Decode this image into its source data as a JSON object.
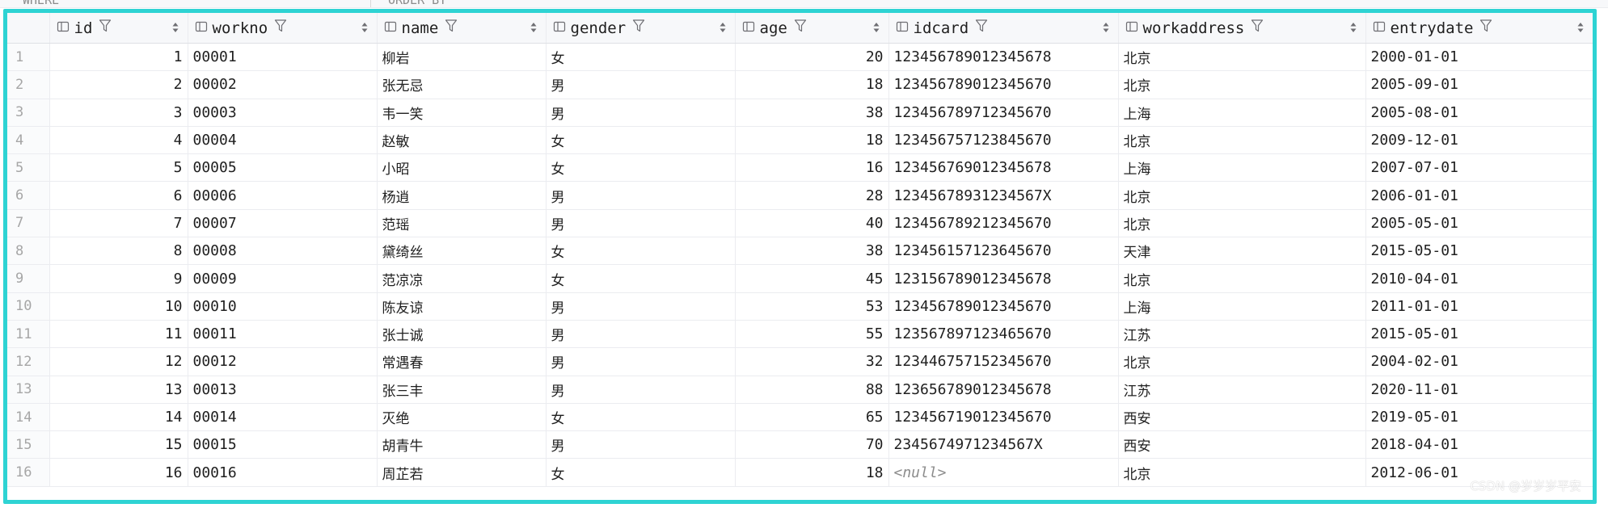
{
  "topbar": {
    "left_text": "WHERE",
    "right_text": "ORDER BY"
  },
  "columns": [
    {
      "name": "id",
      "icon": "column-icon"
    },
    {
      "name": "workno",
      "icon": "column-icon"
    },
    {
      "name": "name",
      "icon": "column-icon"
    },
    {
      "name": "gender",
      "icon": "column-icon"
    },
    {
      "name": "age",
      "icon": "column-icon"
    },
    {
      "name": "idcard",
      "icon": "column-icon"
    },
    {
      "name": "workaddress",
      "icon": "column-icon"
    },
    {
      "name": "entrydate",
      "icon": "column-icon"
    }
  ],
  "rows": [
    {
      "rn": "1",
      "id": "1",
      "workno": "00001",
      "name": "柳岩",
      "gender": "女",
      "age": "20",
      "idcard": "123456789012345678",
      "workaddress": "北京",
      "entrydate": "2000-01-01"
    },
    {
      "rn": "2",
      "id": "2",
      "workno": "00002",
      "name": "张无忌",
      "gender": "男",
      "age": "18",
      "idcard": "123456789012345670",
      "workaddress": "北京",
      "entrydate": "2005-09-01"
    },
    {
      "rn": "3",
      "id": "3",
      "workno": "00003",
      "name": "韦一笑",
      "gender": "男",
      "age": "38",
      "idcard": "123456789712345670",
      "workaddress": "上海",
      "entrydate": "2005-08-01"
    },
    {
      "rn": "4",
      "id": "4",
      "workno": "00004",
      "name": "赵敏",
      "gender": "女",
      "age": "18",
      "idcard": "123456757123845670",
      "workaddress": "北京",
      "entrydate": "2009-12-01"
    },
    {
      "rn": "5",
      "id": "5",
      "workno": "00005",
      "name": "小昭",
      "gender": "女",
      "age": "16",
      "idcard": "123456769012345678",
      "workaddress": "上海",
      "entrydate": "2007-07-01"
    },
    {
      "rn": "6",
      "id": "6",
      "workno": "00006",
      "name": "杨逍",
      "gender": "男",
      "age": "28",
      "idcard": "12345678931234567X",
      "workaddress": "北京",
      "entrydate": "2006-01-01"
    },
    {
      "rn": "7",
      "id": "7",
      "workno": "00007",
      "name": "范瑶",
      "gender": "男",
      "age": "40",
      "idcard": "123456789212345670",
      "workaddress": "北京",
      "entrydate": "2005-05-01"
    },
    {
      "rn": "8",
      "id": "8",
      "workno": "00008",
      "name": "黛绮丝",
      "gender": "女",
      "age": "38",
      "idcard": "123456157123645670",
      "workaddress": "天津",
      "entrydate": "2015-05-01"
    },
    {
      "rn": "9",
      "id": "9",
      "workno": "00009",
      "name": "范凉凉",
      "gender": "女",
      "age": "45",
      "idcard": "123156789012345678",
      "workaddress": "北京",
      "entrydate": "2010-04-01"
    },
    {
      "rn": "10",
      "id": "10",
      "workno": "00010",
      "name": "陈友谅",
      "gender": "男",
      "age": "53",
      "idcard": "123456789012345670",
      "workaddress": "上海",
      "entrydate": "2011-01-01"
    },
    {
      "rn": "11",
      "id": "11",
      "workno": "00011",
      "name": "张士诚",
      "gender": "男",
      "age": "55",
      "idcard": "123567897123465670",
      "workaddress": "江苏",
      "entrydate": "2015-05-01"
    },
    {
      "rn": "12",
      "id": "12",
      "workno": "00012",
      "name": "常遇春",
      "gender": "男",
      "age": "32",
      "idcard": "123446757152345670",
      "workaddress": "北京",
      "entrydate": "2004-02-01"
    },
    {
      "rn": "13",
      "id": "13",
      "workno": "00013",
      "name": "张三丰",
      "gender": "男",
      "age": "88",
      "idcard": "123656789012345678",
      "workaddress": "江苏",
      "entrydate": "2020-11-01"
    },
    {
      "rn": "14",
      "id": "14",
      "workno": "00014",
      "name": "灭绝",
      "gender": "女",
      "age": "65",
      "idcard": "123456719012345670",
      "workaddress": "西安",
      "entrydate": "2019-05-01"
    },
    {
      "rn": "15",
      "id": "15",
      "workno": "00015",
      "name": "胡青牛",
      "gender": "男",
      "age": "70",
      "idcard": "2345674971234567X",
      "workaddress": "西安",
      "entrydate": "2018-04-01"
    },
    {
      "rn": "16",
      "id": "16",
      "workno": "00016",
      "name": "周芷若",
      "gender": "女",
      "age": "18",
      "idcard": "<null>",
      "workaddress": "北京",
      "entrydate": "2012-06-01"
    }
  ],
  "watermark": "CSDN @岁岁岁平安",
  "colors": {
    "frame": "#2ed3d3",
    "header_bg": "#f7f8fa",
    "grid": "#ebecf0",
    "rownum": "#a6a6a6",
    "null_text": "#8c8c8c"
  }
}
